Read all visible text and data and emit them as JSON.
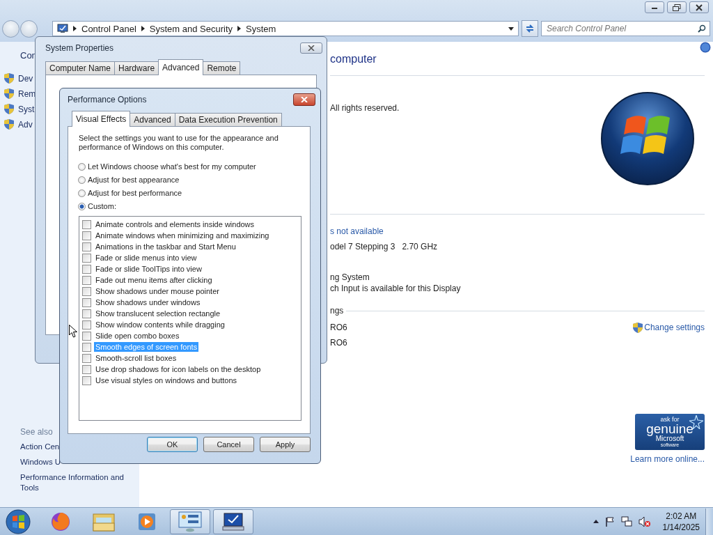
{
  "window": {
    "breadcrumb": [
      "Control Panel",
      "System and Security",
      "System"
    ],
    "search": {
      "placeholder": "Search Control Panel"
    }
  },
  "sidebar": {
    "heading": "Con",
    "items": [
      "Dev",
      "Rem",
      "Syst",
      "Adv"
    ],
    "see_also_heading": "See also",
    "see_also": [
      "Action Cen",
      "Windows U",
      "Performance Information and Tools"
    ]
  },
  "content": {
    "heading": "computer",
    "copyright": "All rights reserved.",
    "rating_link": "s not available",
    "processor": "odel 7 Stepping 3   2.70 GHz",
    "system_type": "ng System",
    "pen_touch": "ch Input is available for this Display",
    "section": "ngs",
    "computer_name": "RO6",
    "full_name": "RO6",
    "change_settings": "Change settings",
    "genuine": [
      "ask for",
      "genuine",
      "Microsoft",
      "software"
    ],
    "learn_more": "Learn more online..."
  },
  "system_properties": {
    "title": "System Properties",
    "tabs": [
      {
        "label": "Computer Name",
        "selected": false
      },
      {
        "label": "Hardware",
        "selected": false
      },
      {
        "label": "Advanced",
        "selected": true
      },
      {
        "label": "Remote",
        "selected": false
      }
    ]
  },
  "performance_options": {
    "title": "Performance Options",
    "tabs": [
      {
        "label": "Visual Effects",
        "selected": true
      },
      {
        "label": "Advanced",
        "selected": false
      },
      {
        "label": "Data Execution Prevention",
        "selected": false
      }
    ],
    "description": "Select the settings you want to use for the appearance and performance of Windows on this computer.",
    "radios": [
      {
        "label": "Let Windows choose what's best for my computer",
        "selected": false
      },
      {
        "label": "Adjust for best appearance",
        "selected": false
      },
      {
        "label": "Adjust for best performance",
        "selected": false
      },
      {
        "label": "Custom:",
        "selected": true
      }
    ],
    "effects": [
      {
        "label": "Animate controls and elements inside windows",
        "checked": false,
        "selected": false
      },
      {
        "label": "Animate windows when minimizing and maximizing",
        "checked": false,
        "selected": false
      },
      {
        "label": "Animations in the taskbar and Start Menu",
        "checked": false,
        "selected": false
      },
      {
        "label": "Fade or slide menus into view",
        "checked": false,
        "selected": false
      },
      {
        "label": "Fade or slide ToolTips into view",
        "checked": false,
        "selected": false
      },
      {
        "label": "Fade out menu items after clicking",
        "checked": false,
        "selected": false
      },
      {
        "label": "Show shadows under mouse pointer",
        "checked": false,
        "selected": false
      },
      {
        "label": "Show shadows under windows",
        "checked": false,
        "selected": false
      },
      {
        "label": "Show translucent selection rectangle",
        "checked": false,
        "selected": false
      },
      {
        "label": "Show window contents while dragging",
        "checked": false,
        "selected": false
      },
      {
        "label": "Slide open combo boxes",
        "checked": false,
        "selected": false
      },
      {
        "label": "Smooth edges of screen fonts",
        "checked": false,
        "selected": true
      },
      {
        "label": "Smooth-scroll list boxes",
        "checked": false,
        "selected": false
      },
      {
        "label": "Use drop shadows for icon labels on the desktop",
        "checked": false,
        "selected": false
      },
      {
        "label": "Use visual styles on windows and buttons",
        "checked": false,
        "selected": false
      }
    ],
    "buttons": [
      {
        "label": "OK",
        "default": true
      },
      {
        "label": "Cancel",
        "default": false
      },
      {
        "label": "Apply",
        "default": false
      }
    ]
  },
  "taskbar": {
    "apps": [
      {
        "kind": "firefox",
        "active": false
      },
      {
        "kind": "explorer",
        "active": false
      },
      {
        "kind": "media",
        "active": false
      },
      {
        "kind": "control-panel",
        "active": true
      },
      {
        "kind": "system",
        "active": true
      }
    ],
    "time": "2:02 AM",
    "date": "1/14/2025"
  }
}
